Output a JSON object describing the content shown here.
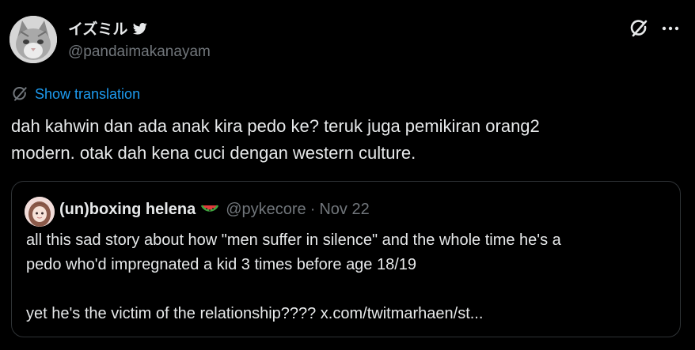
{
  "colors": {
    "background": "#000000",
    "text_primary": "#e7e9ea",
    "text_secondary": "#71767b",
    "link": "#1d9bf0",
    "border": "#2f3336"
  },
  "author": {
    "display_name": "イズミル",
    "handle": "@pandaimakanayam",
    "avatar_icon": "cat-avatar",
    "badge_icon": "bird-icon"
  },
  "actions": {
    "grok_icon": "grok-icon",
    "more_icon": "more-dots-icon"
  },
  "translation": {
    "label": "Show translation",
    "icon": "translate-icon"
  },
  "tweet": {
    "text_line1": "dah kahwin dan ada anak kira pedo ke? teruk juga pemikiran orang2",
    "text_line2": "modern. otak dah kena cuci dengan western culture."
  },
  "quote": {
    "display_name": "(un)boxing helena",
    "emoji": "watermelon-icon",
    "handle": "@pykecore",
    "separator": "·",
    "date": "Nov 22",
    "line1": "all this sad story about how \"men suffer in silence\" and the whole time he's a",
    "line2": "pedo who'd impregnated a kid 3 times before age 18/19",
    "line3": "yet he's the victim of the relationship???? x.com/twitmarhaen/st..."
  }
}
